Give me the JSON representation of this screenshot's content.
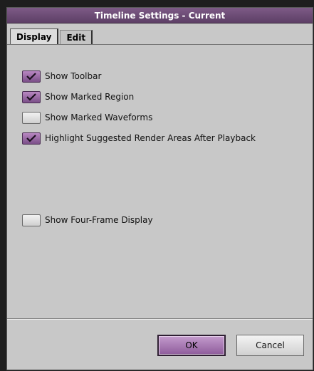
{
  "window": {
    "title": "Timeline Settings - Current"
  },
  "tabs": [
    {
      "label": "Display",
      "active": true
    },
    {
      "label": "Edit",
      "active": false
    }
  ],
  "options": [
    {
      "label": "Show Toolbar",
      "checked": true
    },
    {
      "label": "Show Marked Region",
      "checked": true
    },
    {
      "label": "Show Marked Waveforms",
      "checked": false
    },
    {
      "label": "Highlight Suggested Render Areas After Playback",
      "checked": true
    },
    {
      "label": "Show Four-Frame Display",
      "checked": false
    }
  ],
  "buttons": {
    "ok": "OK",
    "cancel": "Cancel"
  },
  "colors": {
    "accent": "#8e5c9b",
    "titlebar": "#6b4c74",
    "panel": "#c8c8c8"
  }
}
